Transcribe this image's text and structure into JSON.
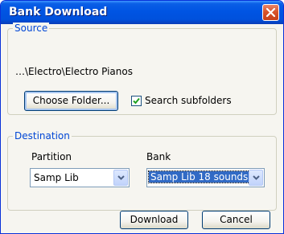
{
  "dialog": {
    "title": "Bank Download"
  },
  "source": {
    "legend": "Source",
    "path": "…\\Electro\\Electro Pianos",
    "choose_folder_label": "Choose Folder...",
    "search_subfolders_label": "Search subfolders",
    "search_subfolders_checked": true
  },
  "destination": {
    "legend": "Destination",
    "partition_label": "Partition",
    "partition_value": "Samp Lib",
    "bank_label": "Bank",
    "bank_value": "Samp Lib 18 sounds"
  },
  "footer": {
    "download_label": "Download",
    "cancel_label": "Cancel"
  },
  "icons": {
    "close": "close-icon",
    "checkmark": "checkmark-icon",
    "dropdown": "chevron-down-icon"
  },
  "colors": {
    "titlebar": "#0054e3",
    "legend_text": "#0046d5",
    "selection": "#316ac5",
    "close_button": "#d8542b"
  }
}
